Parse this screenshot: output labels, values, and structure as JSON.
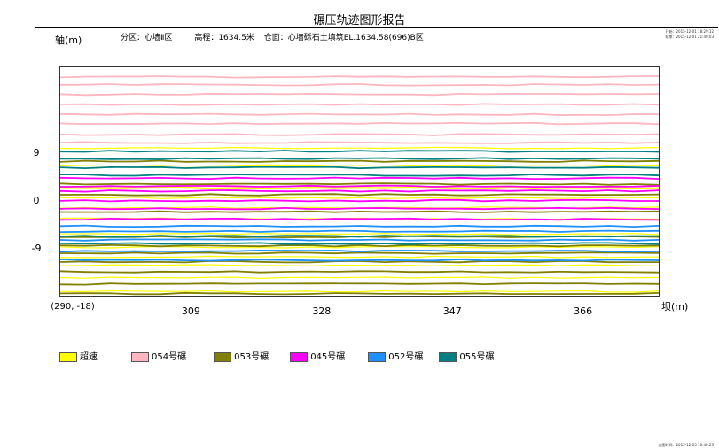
{
  "report": {
    "title": "碾压轨迹图形报告",
    "section": "分区：心墙Ⅱ区",
    "elevation": "高程：1634.5米",
    "surface": "仓面：心墙砾石土填筑EL.1634.58(696)B区",
    "stamp_top_1": "开始：2015-12-01 18:29:12",
    "stamp_top_2": "结束：2015-12-01 21:40:03",
    "stamp_bottom": "出图时间：2015-12-05 10:40:23"
  },
  "chart_data": {
    "type": "line",
    "title": "碾压轨迹图形报告",
    "xlabel": "坝(m)",
    "ylabel": "轴(m)",
    "origin_label": "(290, -18)",
    "xlim": [
      290,
      377
    ],
    "ylim": [
      -18,
      25
    ],
    "xticks": [
      309,
      328,
      347,
      366
    ],
    "yticks": [
      9,
      0,
      -9
    ],
    "grid": false,
    "legend_position": "bottom",
    "series": [
      {
        "name": "超速",
        "color": "#ffff00",
        "track_y": [
          -17.2,
          -14.6,
          -12.3,
          -10.7,
          -8.9,
          -6.4,
          -3.5,
          -1.4,
          0.4,
          2.3,
          6.5,
          9.8
        ]
      },
      {
        "name": "054号碾",
        "color": "#ffb6c1",
        "track_y": [
          23.2,
          21.7,
          19.9,
          18.0,
          16.1,
          14.4,
          12.3,
          10.8
        ]
      },
      {
        "name": "053号碾",
        "color": "#808000",
        "track_y": [
          -17.6,
          -15.8,
          -13.5,
          -11.6,
          -10.0,
          -8.6,
          -6.9,
          -2.2,
          1.0,
          3.0,
          7.3
        ]
      },
      {
        "name": "045号碾",
        "color": "#ff00ff",
        "track_y": [
          4.1,
          2.6,
          1.7,
          -0.1,
          -1.6,
          -3.6
        ]
      },
      {
        "name": "052号碾",
        "color": "#1e90ff",
        "track_y": [
          -4.9,
          -5.9,
          -7.5,
          -9.6,
          -11.3
        ]
      },
      {
        "name": "055号碾",
        "color": "#008080",
        "track_y": [
          9.2,
          7.8,
          6.1,
          4.7,
          -6.8,
          -8.2
        ]
      }
    ]
  }
}
